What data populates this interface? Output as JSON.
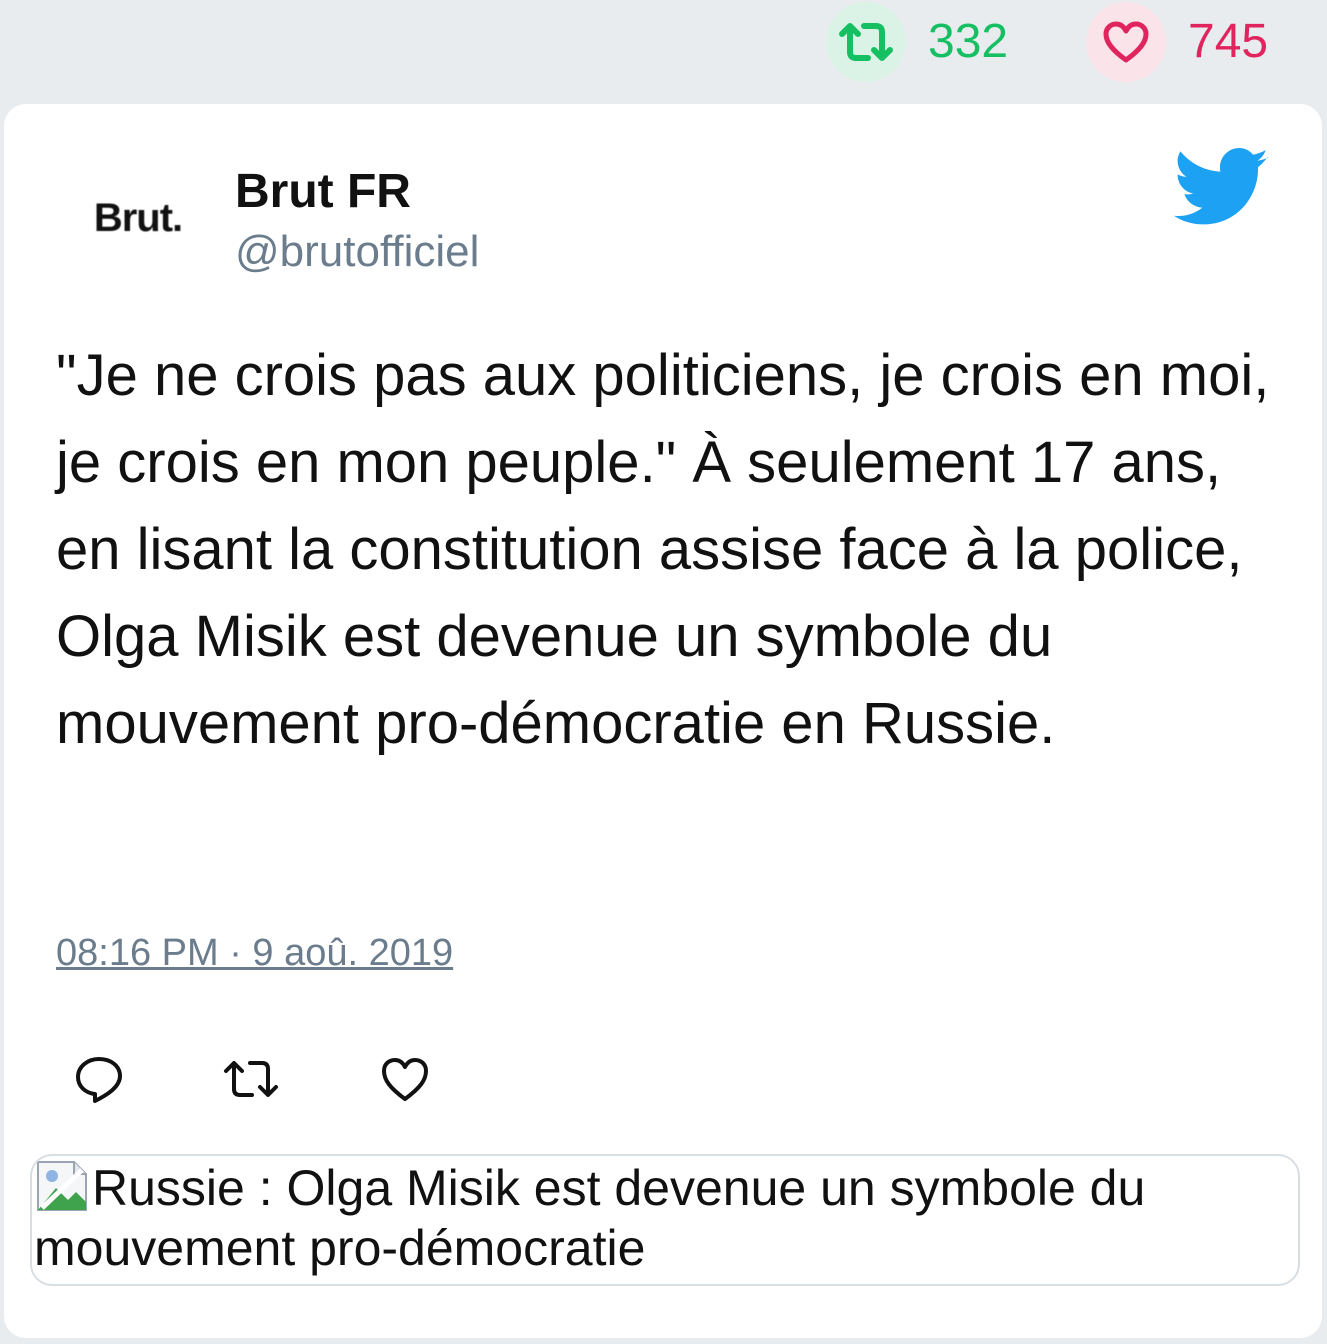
{
  "stats": {
    "retweets": "332",
    "likes": "745",
    "retweet_color": "#17bf63",
    "like_color": "#e0245e"
  },
  "tweet": {
    "avatar_text": "Brut.",
    "author_name": "Brut FR",
    "author_handle": "@brutofficiel",
    "text": "\"Je ne crois pas aux politiciens, je crois en moi, je crois en mon peuple.\" À seulement 17 ans, en lisant la constitution assise face à la police, Olga Misik est devenue un symbole du mouvement pro-démocratie en Russie.",
    "timestamp": "08:16 PM · 9 aoû. 2019",
    "brand_icon": "twitter-bird-icon",
    "brand_color": "#1da1f2"
  },
  "actions": {
    "reply_icon": "reply-icon",
    "retweet_icon": "retweet-icon",
    "like_icon": "heart-icon"
  },
  "link_card": {
    "title": "Russie : Olga Misik est devenue un symbole du mouvement pro-démocratie",
    "image_icon": "broken-image-icon"
  }
}
